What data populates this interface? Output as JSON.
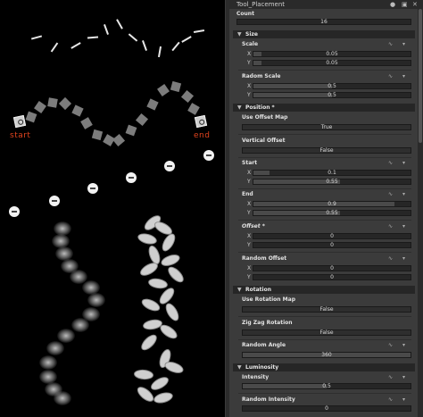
{
  "viewport": {
    "start_label": "start",
    "end_label": "end"
  },
  "panel": {
    "title": "Tool_Placement",
    "title_icons": [
      "lock-icon",
      "window-icon",
      "close-icon"
    ],
    "count": {
      "label": "Count",
      "value": "16"
    },
    "size": {
      "section": "Size",
      "scale": {
        "label": "Scale",
        "x": "0.05",
        "y": "0.05",
        "x_fill": 0.05,
        "y_fill": 0.05
      },
      "random_scale": {
        "label": "Radom Scale",
        "x": "0.5",
        "y": "0.5",
        "x_fill": 0.5,
        "y_fill": 0.5
      }
    },
    "position": {
      "section": "Position *",
      "use_offset_map": {
        "label": "Use Offset Map",
        "value": "True"
      },
      "vertical_offset": {
        "label": "Vertical Offset",
        "value": "False"
      },
      "start": {
        "label": "Start",
        "x": "0.1",
        "y": "0.55",
        "x_fill": 0.1,
        "y_fill": 0.55
      },
      "end": {
        "label": "End",
        "x": "0.9",
        "y": "0.55",
        "x_fill": 0.9,
        "y_fill": 0.55
      },
      "offset": {
        "label": "Offset *",
        "x": "0",
        "y": "0",
        "x_fill": 0,
        "y_fill": 0
      },
      "random_offset": {
        "label": "Random Offset",
        "x": "0",
        "y": "0",
        "x_fill": 0,
        "y_fill": 0
      }
    },
    "rotation": {
      "section": "Rotation",
      "use_rotation_map": {
        "label": "Use Rotation Map",
        "value": "False"
      },
      "zig_zag_rotation": {
        "label": "Zig Zag Rotation",
        "value": "False"
      },
      "random_angle": {
        "label": "Random Angle",
        "value": "360",
        "fill": 1
      }
    },
    "luminosity": {
      "section": "Luminosity",
      "intensity": {
        "label": "Intensity",
        "value": "0.5",
        "fill": 0.5
      },
      "random_intensity": {
        "label": "Random Intensity",
        "value": "0",
        "fill": 0
      }
    }
  }
}
